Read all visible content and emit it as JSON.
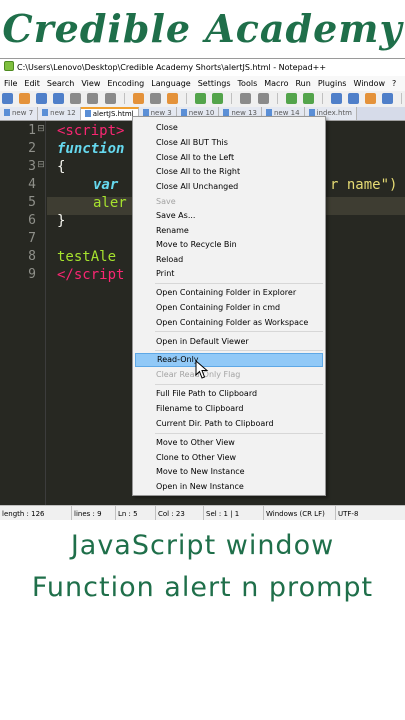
{
  "brand": {
    "title": "Credible Academy"
  },
  "window": {
    "title": "C:\\Users\\Lenovo\\Desktop\\Credible Academy Shorts\\alertJS.html - Notepad++"
  },
  "menubar": [
    "File",
    "Edit",
    "Search",
    "View",
    "Encoding",
    "Language",
    "Settings",
    "Tools",
    "Macro",
    "Run",
    "Plugins",
    "Window",
    "?"
  ],
  "tabs": [
    "new 7",
    "new 12",
    "alertJS.html",
    "new 3",
    "new 10",
    "new 13",
    "new 14",
    "index.htm"
  ],
  "editor": {
    "line_numbers": [
      "1",
      "2",
      "3",
      "4",
      "5",
      "6",
      "7",
      "8",
      "9"
    ],
    "lines": {
      "l1": "<script>",
      "l2_kw": "function",
      "l3": "{",
      "l4_kw": "var",
      "l4_str": "r name\")",
      "l5": "aler",
      "l6": "}",
      "l8": "testAle",
      "l9": "</script"
    }
  },
  "context_menu": {
    "items": [
      "Close",
      "Close All BUT This",
      "Close All to the Left",
      "Close All to the Right",
      "Close All Unchanged",
      "Save",
      "Save As...",
      "Rename",
      "Move to Recycle Bin",
      "Reload",
      "Print",
      "Open Containing Folder in Explorer",
      "Open Containing Folder in cmd",
      "Open Containing Folder as Workspace",
      "Open in Default Viewer",
      "Read-Only",
      "Clear Read-Only Flag",
      "Full File Path to Clipboard",
      "Filename to Clipboard",
      "Current Dir. Path to Clipboard",
      "Move to Other View",
      "Clone to Other View",
      "Move to New Instance",
      "Open in New Instance"
    ]
  },
  "statusbar": {
    "length": "length : 126",
    "lines": "lines : 9",
    "ln": "Ln : 5",
    "col": "Col : 23",
    "sel": "Sel : 1 | 1",
    "eol": "Windows (CR LF)",
    "encoding": "UTF-8"
  },
  "captions": {
    "line1": "JavaScript window",
    "line2": "Function alert n prompt"
  },
  "colors": {
    "brand_green": "#1f6f4a",
    "editor_bg": "#272822",
    "menu_highlight": "#91c9f7"
  }
}
